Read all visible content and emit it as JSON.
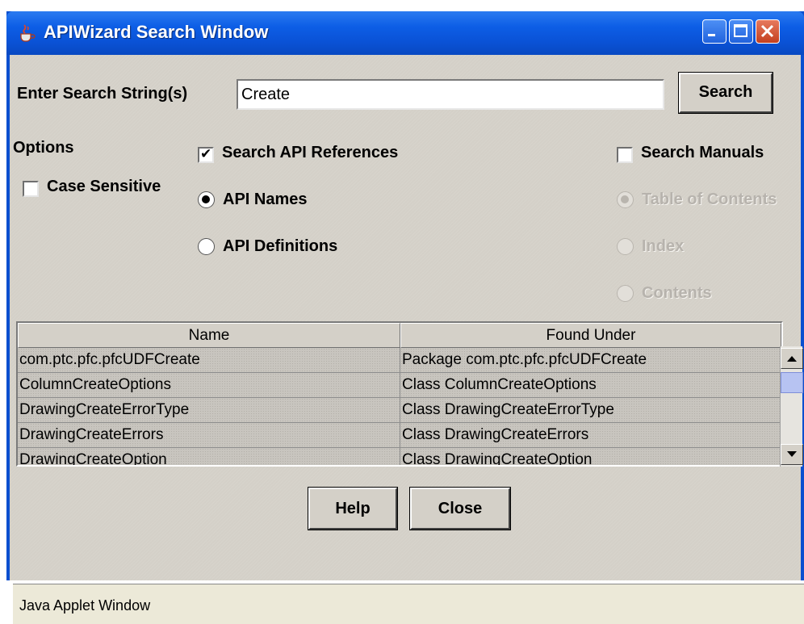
{
  "window": {
    "title": "APIWizard Search Window",
    "icon": "java-cup-icon"
  },
  "search": {
    "label": "Enter Search String(s)",
    "value": "Create",
    "button": "Search"
  },
  "options": {
    "heading": "Options",
    "case_sensitive": {
      "label": "Case Sensitive",
      "checked": false
    },
    "search_api_references": {
      "label": "Search API References",
      "checked": true
    },
    "api_names": {
      "label": "API Names",
      "selected": true
    },
    "api_definitions": {
      "label": "API Definitions",
      "selected": false
    },
    "search_manuals": {
      "label": "Search Manuals",
      "checked": false
    },
    "table_of_contents": {
      "label": "Table of Contents",
      "selected": true,
      "disabled": true
    },
    "index": {
      "label": "Index",
      "selected": false,
      "disabled": true
    },
    "contents": {
      "label": "Contents",
      "selected": false,
      "disabled": true
    }
  },
  "results": {
    "columns": [
      "Name",
      "Found Under"
    ],
    "rows": [
      [
        "com.ptc.pfc.pfcUDFCreate",
        "Package com.ptc.pfc.pfcUDFCreate"
      ],
      [
        "ColumnCreateOptions",
        "Class ColumnCreateOptions"
      ],
      [
        "DrawingCreateErrorType",
        "Class DrawingCreateErrorType"
      ],
      [
        "DrawingCreateErrors",
        "Class DrawingCreateErrors"
      ],
      [
        "DrawingCreateOption",
        "Class DrawingCreateOption"
      ]
    ]
  },
  "buttons": {
    "help": "Help",
    "close": "Close"
  },
  "status": {
    "text": "Java Applet Window"
  }
}
